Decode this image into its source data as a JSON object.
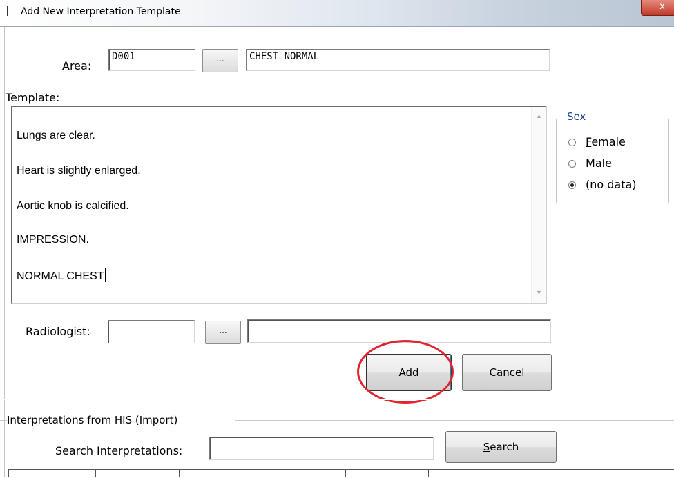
{
  "window": {
    "title": "Add New Interpretation Template",
    "close_label": "x"
  },
  "area": {
    "label": "Area:",
    "code_value": "D001",
    "browse_label": "...",
    "name_value": "CHEST NORMAL"
  },
  "template": {
    "label": "Template:",
    "lines": [
      "Lungs are clear.",
      "Heart is slightly enlarged.",
      "Aortic knob is calcified.",
      "IMPRESSION.",
      "NORMAL CHEST"
    ]
  },
  "sex": {
    "legend": "Sex",
    "options": [
      {
        "label": "Female",
        "access_key": "F",
        "rest": "emale",
        "checked": false
      },
      {
        "label": "Male",
        "access_key": "M",
        "rest": "ale",
        "checked": false
      },
      {
        "label": "(no data)",
        "checked": true
      }
    ]
  },
  "radiologist": {
    "label": "Radiologist:",
    "code_value": "",
    "browse_label": "...",
    "name_value": ""
  },
  "buttons": {
    "add": {
      "access_key": "A",
      "rest": "dd"
    },
    "cancel": {
      "access_key": "C",
      "rest": "ancel"
    }
  },
  "import_section": {
    "legend": "Interpretations from HIS (Import)",
    "search_label": "Search Interpretations:",
    "search_value": "",
    "search_button": {
      "access_key": "S",
      "rest": "earch"
    }
  },
  "colors": {
    "annotation": "#e1252e",
    "group_legend": "#1a3f8f"
  }
}
